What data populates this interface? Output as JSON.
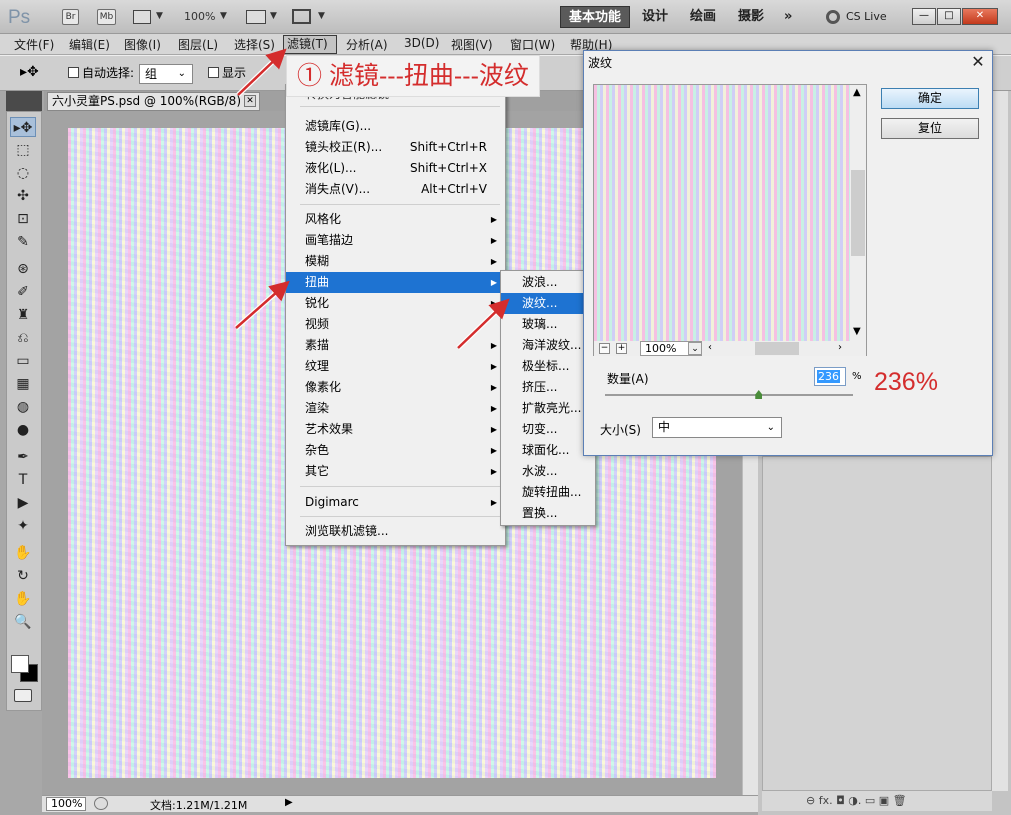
{
  "appbar": {
    "logo": "Ps",
    "br": "Br",
    "mb": "Mb",
    "zoom": "100%",
    "workspaces": [
      "基本功能",
      "设计",
      "绘画",
      "摄影"
    ],
    "more": "»",
    "cslive": "CS Live",
    "win_min": "—",
    "win_max": "□",
    "win_close": "✕"
  },
  "menubar": [
    "文件(F)",
    "编辑(E)",
    "图像(I)",
    "图层(L)",
    "选择(S)",
    "滤镜(T)",
    "分析(A)",
    "3D(D)",
    "视图(V)",
    "窗口(W)",
    "帮助(H)"
  ],
  "options": {
    "auto_select": "自动选择:",
    "auto_select_value": "组",
    "show": "显示"
  },
  "doc_tab": "六小灵童PS.psd @ 100%(RGB/8)",
  "filter_menu": {
    "partial_top": "转换为智能滤镜",
    "shortcut_top": "F",
    "group1": [
      {
        "label": "滤镜库(G)...",
        "shortcut": ""
      },
      {
        "label": "镜头校正(R)...",
        "shortcut": "Shift+Ctrl+R"
      },
      {
        "label": "液化(L)...",
        "shortcut": "Shift+Ctrl+X"
      },
      {
        "label": "消失点(V)...",
        "shortcut": "Alt+Ctrl+V"
      }
    ],
    "group2": [
      "风格化",
      "画笔描边",
      "模糊",
      "扭曲",
      "锐化",
      "视频",
      "素描",
      "纹理",
      "像素化",
      "渲染",
      "艺术效果",
      "杂色",
      "其它"
    ],
    "group3": [
      "Digimarc"
    ],
    "group4": [
      "浏览联机滤镜..."
    ],
    "highlighted": "扭曲"
  },
  "distort_submenu": {
    "items": [
      "波浪...",
      "波纹...",
      "玻璃...",
      "海洋波纹...",
      "极坐标...",
      "挤压...",
      "扩散亮光...",
      "切变...",
      "球面化...",
      "水波...",
      "旋转扭曲...",
      "置换..."
    ],
    "highlighted": "波纹..."
  },
  "annotation": {
    "step": "① 滤镜---扭曲---波纹",
    "value": "236%"
  },
  "dialog": {
    "title": "波纹",
    "ok": "确定",
    "reset": "复位",
    "preview_zoom": "100%",
    "zoom_out": "−",
    "zoom_in": "+",
    "amount_label": "数量(A)",
    "amount_value": "236",
    "amount_unit": "%",
    "amount_fraction": 0.62,
    "size_label": "大小(S)",
    "size_value": "中"
  },
  "status": {
    "zoom": "100%",
    "doc": "文档:1.21M/1.21M"
  },
  "tools": [
    "▸✥",
    "⬚",
    "◌",
    "✣",
    "⊡",
    "✎",
    "⊛",
    "✐",
    "♜",
    "⎌",
    "▭",
    "▦",
    "◍",
    "●",
    "✒",
    "T",
    "▶",
    "✦",
    "✋",
    "↻",
    "✋",
    "🔍"
  ],
  "colors": {
    "highlight": "#1e73d2",
    "annotation": "#d42d2d",
    "arrow": "#d42d2d"
  }
}
